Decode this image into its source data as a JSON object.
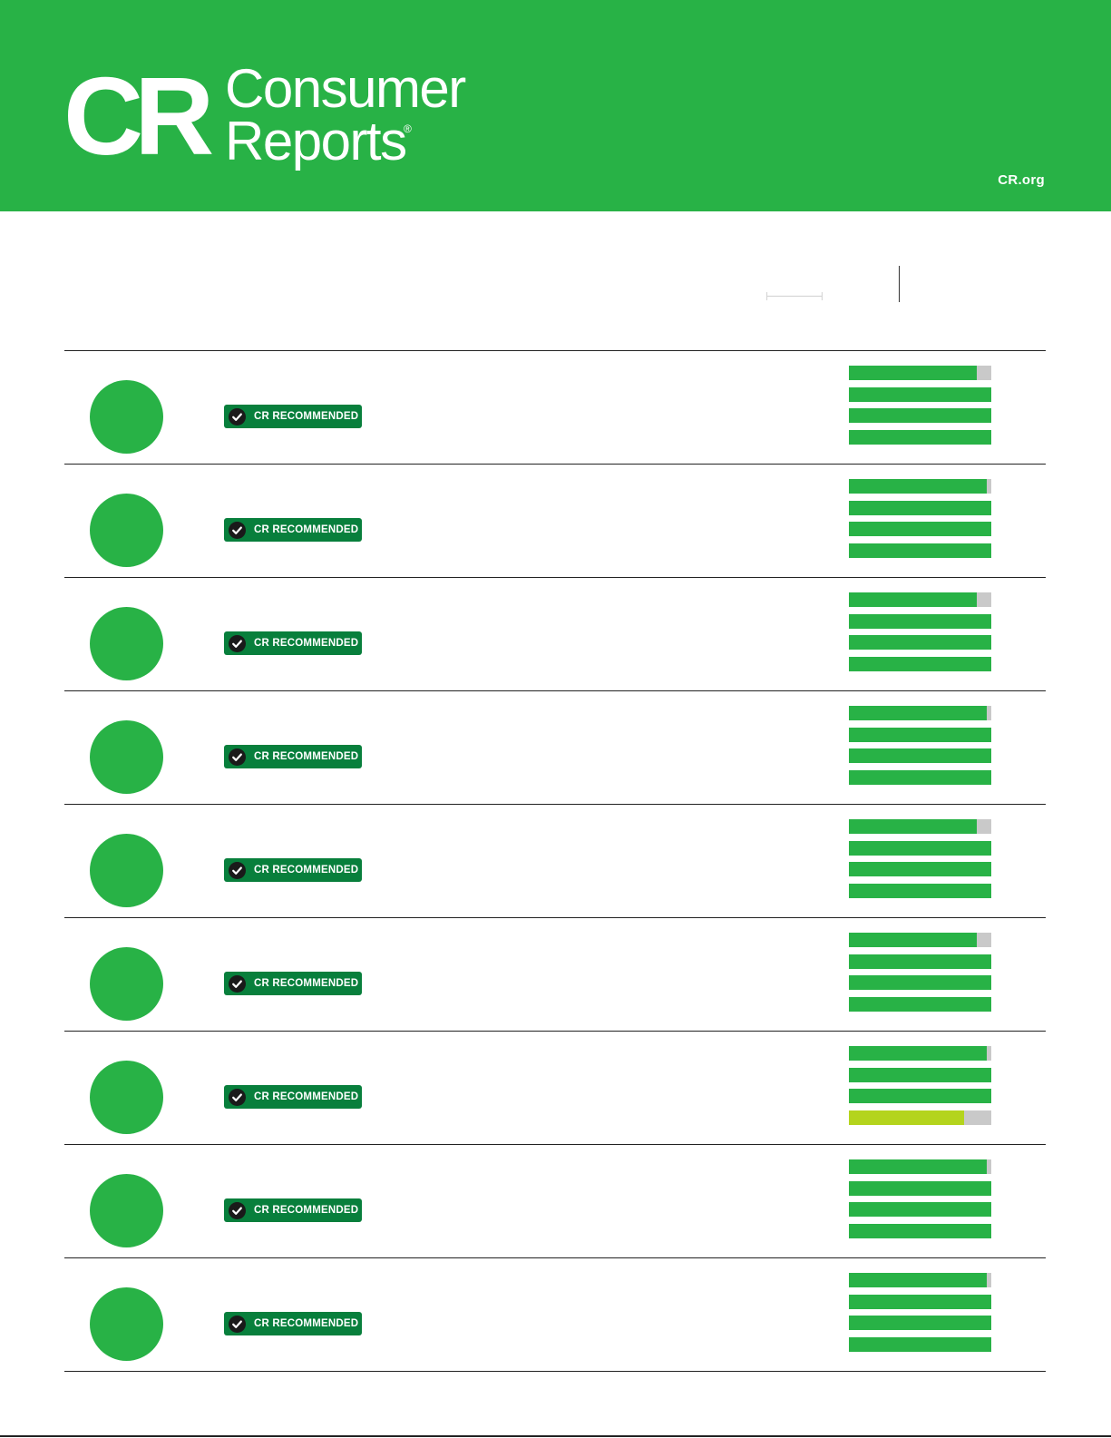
{
  "brand": {
    "monogram": "CR",
    "name_line1": "Consumer",
    "name_line2": "Reports",
    "registered_mark": "®",
    "site_link": "CR.org",
    "header_color": "#28b246"
  },
  "colors": {
    "score_green": "#28b246",
    "badge_green": "#087f3c",
    "bar_track": "#c9c9c9",
    "rating_excellent": "#28b246",
    "rating_very_good": "#b4d41d",
    "check_disc": "#1a1a1a"
  },
  "rows": [
    {
      "badge": "CR RECOMMENDED",
      "badge_icon": "check-circle-icon",
      "ratings": [
        0.9,
        1.0,
        1.0,
        1.0
      ],
      "rating_levels": [
        "excellent",
        "excellent",
        "excellent",
        "excellent"
      ]
    },
    {
      "badge": "CR RECOMMENDED",
      "badge_icon": "check-circle-icon",
      "ratings": [
        0.97,
        1.0,
        1.0,
        1.0
      ],
      "rating_levels": [
        "excellent",
        "excellent",
        "excellent",
        "excellent"
      ]
    },
    {
      "badge": "CR RECOMMENDED",
      "badge_icon": "check-circle-icon",
      "ratings": [
        0.9,
        1.0,
        1.0,
        1.0
      ],
      "rating_levels": [
        "excellent",
        "excellent",
        "excellent",
        "excellent"
      ]
    },
    {
      "badge": "CR RECOMMENDED",
      "badge_icon": "check-circle-icon",
      "ratings": [
        0.97,
        1.0,
        1.0,
        1.0
      ],
      "rating_levels": [
        "excellent",
        "excellent",
        "excellent",
        "excellent"
      ]
    },
    {
      "badge": "CR RECOMMENDED",
      "badge_icon": "check-circle-icon",
      "ratings": [
        0.9,
        1.0,
        1.0,
        1.0
      ],
      "rating_levels": [
        "excellent",
        "excellent",
        "excellent",
        "excellent"
      ]
    },
    {
      "badge": "CR RECOMMENDED",
      "badge_icon": "check-circle-icon",
      "ratings": [
        0.9,
        1.0,
        1.0,
        1.0
      ],
      "rating_levels": [
        "excellent",
        "excellent",
        "excellent",
        "excellent"
      ]
    },
    {
      "badge": "CR RECOMMENDED",
      "badge_icon": "check-circle-icon",
      "ratings": [
        0.97,
        1.0,
        1.0,
        0.81
      ],
      "rating_levels": [
        "excellent",
        "excellent",
        "excellent",
        "very_good"
      ]
    },
    {
      "badge": "CR RECOMMENDED",
      "badge_icon": "check-circle-icon",
      "ratings": [
        0.97,
        1.0,
        1.0,
        1.0
      ],
      "rating_levels": [
        "excellent",
        "excellent",
        "excellent",
        "excellent"
      ]
    },
    {
      "badge": "CR RECOMMENDED",
      "badge_icon": "check-circle-icon",
      "ratings": [
        0.97,
        1.0,
        1.0,
        1.0
      ],
      "rating_levels": [
        "excellent",
        "excellent",
        "excellent",
        "excellent"
      ]
    }
  ]
}
